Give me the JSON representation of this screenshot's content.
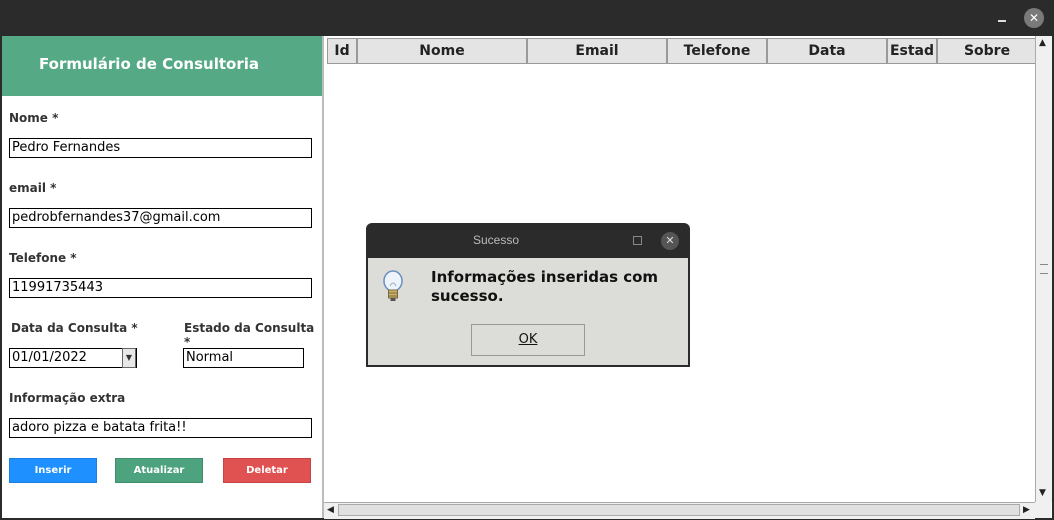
{
  "titlebar": {
    "minimize_icon": "minimize-icon",
    "close_icon": "close-icon"
  },
  "form": {
    "header": "Formulário de Consultoria",
    "nome_label": "Nome *",
    "nome_value": "Pedro Fernandes",
    "email_label": "email *",
    "email_value": "pedrobfernandes37@gmail.com",
    "telefone_label": "Telefone *",
    "telefone_value": "11991735443",
    "data_label": "Data da Consulta *",
    "data_value": "01/01/2022",
    "estado_label": "Estado da Consulta *",
    "estado_value": "Normal",
    "extra_label": "Informação extra",
    "extra_value": "adoro pizza e batata frita!!",
    "buttons": {
      "inserir": "Inserir",
      "atualizar": "Atualizar",
      "deletar": "Deletar"
    },
    "colors": {
      "header": "#55aa85",
      "inserir": "#1e90ff",
      "atualizar": "#4ca37e",
      "deletar": "#e05252"
    }
  },
  "table": {
    "columns": [
      "Id",
      "Nome",
      "Email",
      "Telefone",
      "Data",
      "Estad",
      "Sobre"
    ],
    "rows": []
  },
  "dialog": {
    "title": "Sucesso",
    "message": "Informações inseridas com sucesso.",
    "ok_label": "OK",
    "icon": "lightbulb-icon"
  }
}
